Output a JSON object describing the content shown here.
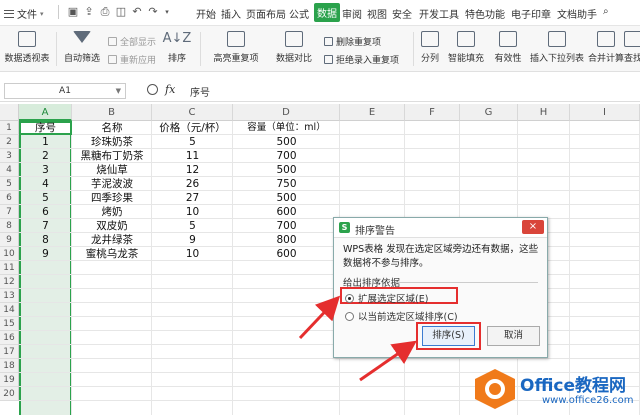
{
  "menubar": {
    "file_label": "文件",
    "items": [
      "开始",
      "插入",
      "页面布局",
      "公式",
      "数据",
      "审阅",
      "视图",
      "安全",
      "开发工具",
      "特色功能",
      "电子印章",
      "文档助手"
    ],
    "active_item": "数据"
  },
  "ribbon": {
    "pivot": "数据透视表",
    "autofilter": "自动筛选",
    "show_all": "全部显示",
    "reapply": "重新应用",
    "sort": "排序",
    "highlight_dup": "高亮重复项",
    "compare": "数据对比",
    "remove_dup": "删除重复项",
    "reject_dup": "拒绝录入重复项",
    "split": "分列",
    "smart_fill": "智能填充",
    "validity": "有效性",
    "insert_dropdown": "插入下拉列表",
    "merge_calc": "合并计算",
    "lookup": "查找"
  },
  "formula_bar": {
    "name_box": "A1",
    "fx": "fx",
    "content": "序号"
  },
  "columns": [
    "A",
    "B",
    "C",
    "D",
    "E",
    "F",
    "G",
    "H",
    "I"
  ],
  "rows": [
    "1",
    "2",
    "3",
    "4",
    "5",
    "6",
    "7",
    "8",
    "9",
    "10",
    "11",
    "12",
    "13",
    "14",
    "15",
    "16",
    "17",
    "18",
    "19",
    "20"
  ],
  "table": {
    "headers": [
      "序号",
      "名称",
      "价格（元/杯）",
      "容量（单位：ml）"
    ],
    "data": [
      [
        "1",
        "珍珠奶茶",
        "5",
        "500"
      ],
      [
        "2",
        "黑糖布丁奶茶",
        "11",
        "700"
      ],
      [
        "3",
        "烧仙草",
        "12",
        "500"
      ],
      [
        "4",
        "芋泥波波",
        "26",
        "750"
      ],
      [
        "5",
        "四季珍果",
        "27",
        "500"
      ],
      [
        "6",
        "烤奶",
        "10",
        "600"
      ],
      [
        "7",
        "双皮奶",
        "5",
        "700"
      ],
      [
        "8",
        "龙井绿茶",
        "9",
        "800"
      ],
      [
        "9",
        "蜜桃乌龙茶",
        "10",
        "600"
      ]
    ]
  },
  "dialog": {
    "title": "排序警告",
    "close": "×",
    "message": "WPS表格 发现在选定区域旁边还有数据，这些数据将不参与排序。",
    "group_label": "给出排序依据",
    "option_expand": "扩展选定区域(E)",
    "option_current": "以当前选定区域排序(C)",
    "sort_button": "排序(S)",
    "cancel_button": "取消"
  },
  "watermark": {
    "brand": "Office教程网",
    "url": "www.office26.com"
  },
  "colors": {
    "accent": "#2ba24c",
    "highlight": "#e52e2e"
  }
}
